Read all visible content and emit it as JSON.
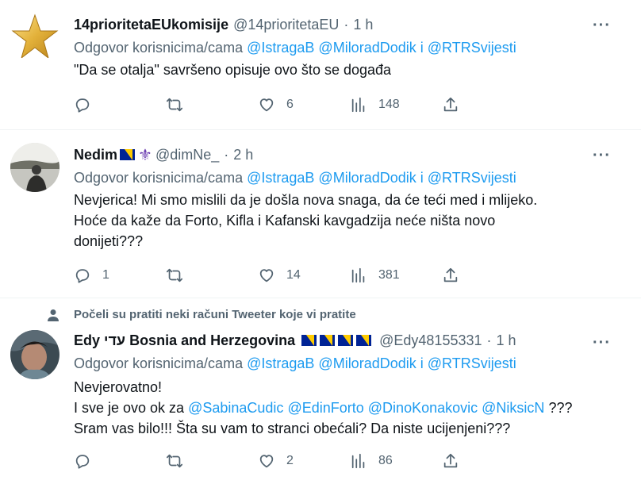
{
  "tweets": [
    {
      "name": "14prioritetaEUkomisije",
      "handle": "@14prioritetaEU",
      "time": "1 h",
      "reply_prefix": "Odgovor korisnicima/cama",
      "mentions": [
        "@IstragaB",
        "@MiloradDodik"
      ],
      "mentions_and": "i",
      "mention_last": "@RTRSvijesti",
      "text_lines": [
        "\"Da se otalja\" savršeno opisuje ovo što se događa"
      ],
      "reply_count": "",
      "retweet_count": "",
      "like_count": "6",
      "view_count": "148",
      "avatar_icon": "gold-star-icon"
    },
    {
      "name": "Nedim",
      "handle": "@dimNe_",
      "time": "2 h",
      "reply_prefix": "Odgovor korisnicima/cama",
      "mentions": [
        "@IstragaB",
        "@MiloradDodik"
      ],
      "mentions_and": "i",
      "mention_last": "@RTRSvijesti",
      "text_lines": [
        "Nevjerica! Mi smo mislili da je došla nova snaga, da će teći med i mlijeko.",
        "Hoće da kaže da Forto, Kifla i Kafanski kavgadzija neće ništa novo",
        "donijeti???"
      ],
      "fleur": "⚜",
      "reply_count": "1",
      "retweet_count": "",
      "like_count": "14",
      "view_count": "381"
    },
    {
      "social_context": "Počeli su pratiti neki računi Tweeter koje vi pratite",
      "name": "Edy עדי Bosnia and Herzegovina",
      "handle": "@Edy48155331",
      "time": "1 h",
      "reply_prefix": "Odgovor korisnicima/cama",
      "mentions": [
        "@IstragaB",
        "@MiloradDodik"
      ],
      "mentions_and": "i",
      "mention_last": "@RTRSvijesti",
      "line1": "Nevjerovatno!",
      "line2_prefix": "I sve je ovo ok za",
      "line2_mentions": [
        "@SabinaCudic",
        "@EdinForto",
        "@DinoKonakovic",
        "@NiksicN"
      ],
      "line2_suffix": "???",
      "line3": "Sram vas bilo!!! Šta su vam to stranci obećali? Da niste ucijenjeni???",
      "reply_count": "",
      "retweet_count": "",
      "like_count": "2",
      "view_count": "86"
    }
  ],
  "dot": "·",
  "more": "···",
  "colors": {
    "link": "#1d9bf0",
    "muted": "#536471",
    "text": "#0f1419",
    "flag_blue": "#002395",
    "flag_yellow": "#fecb00"
  }
}
